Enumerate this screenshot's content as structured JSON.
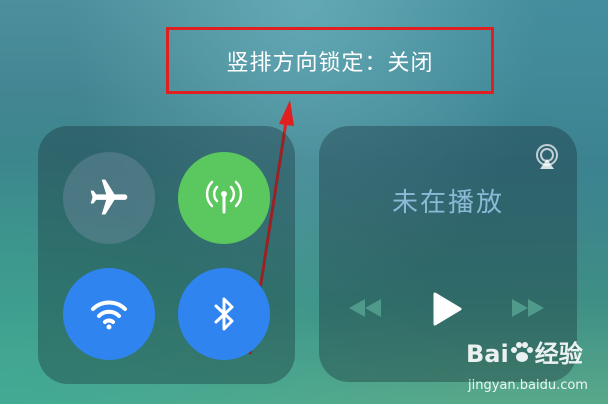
{
  "toast": {
    "text": "竖排方向锁定：关闭"
  },
  "connectivity": {
    "airplane": "airplane-icon",
    "cellular": "cellular-antenna-icon",
    "wifi": "wifi-icon",
    "bluetooth": "bluetooth-icon"
  },
  "media": {
    "status_text": "未在播放",
    "airplay_icon": "airplay-icon",
    "controls": [
      "rewind-icon",
      "play-icon",
      "fast-forward-icon"
    ]
  },
  "watermark": {
    "brand": "Bai",
    "brand_suffix": "经验",
    "url": "jingyan.baidu.com"
  },
  "colors": {
    "highlight_box": "#e02020",
    "cellular_on": "#5ac85e",
    "wifi_on": "#2f84f0",
    "bluetooth_on": "#2f84f0",
    "media_text": "#8cbad6"
  }
}
